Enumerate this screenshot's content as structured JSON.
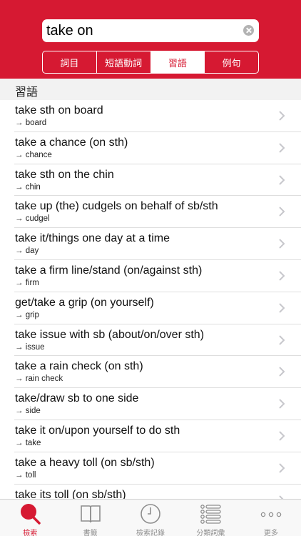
{
  "search": {
    "value": "take on"
  },
  "segments": [
    {
      "label": "詞目",
      "active": false
    },
    {
      "label": "短語動詞",
      "active": false
    },
    {
      "label": "習語",
      "active": true
    },
    {
      "label": "例句",
      "active": false
    }
  ],
  "section": {
    "title": "習語"
  },
  "items": [
    {
      "title": "take sth on board",
      "sub": "→ board"
    },
    {
      "title": "take a chance (on sth)",
      "sub": "→ chance"
    },
    {
      "title": "take sth on the chin",
      "sub": "→ chin"
    },
    {
      "title": "take up (the) cudgels on behalf of sb/sth",
      "sub": "→ cudgel"
    },
    {
      "title": "take it/things one day at a time",
      "sub": "→ day"
    },
    {
      "title": "take a firm line/stand (on/against sth)",
      "sub": "→ firm"
    },
    {
      "title": "get/take a grip (on yourself)",
      "sub": "→ grip"
    },
    {
      "title": "take issue with sb (about/on/over sth)",
      "sub": "→ issue"
    },
    {
      "title": "take a rain check (on sth)",
      "sub": "→ rain check"
    },
    {
      "title": "take/draw sb to one side",
      "sub": "→ side"
    },
    {
      "title": "take it on/upon yourself to do sth",
      "sub": "→ take"
    },
    {
      "title": "take a heavy toll (on sb/sth)",
      "sub": "→ toll"
    },
    {
      "title": "take its toll (on sb/sth)",
      "sub": ""
    }
  ],
  "tabs": [
    {
      "label": "檢索",
      "icon": "search-icon",
      "active": true
    },
    {
      "label": "書籤",
      "icon": "bookmark-book-icon",
      "active": false
    },
    {
      "label": "檢索記錄",
      "icon": "clock-icon",
      "active": false
    },
    {
      "label": "分類詞彙",
      "icon": "list-icon",
      "active": false
    },
    {
      "label": "更多",
      "icon": "more-icon",
      "active": false
    }
  ],
  "colors": {
    "accent": "#d61932",
    "inactive": "#8e8e8e"
  }
}
